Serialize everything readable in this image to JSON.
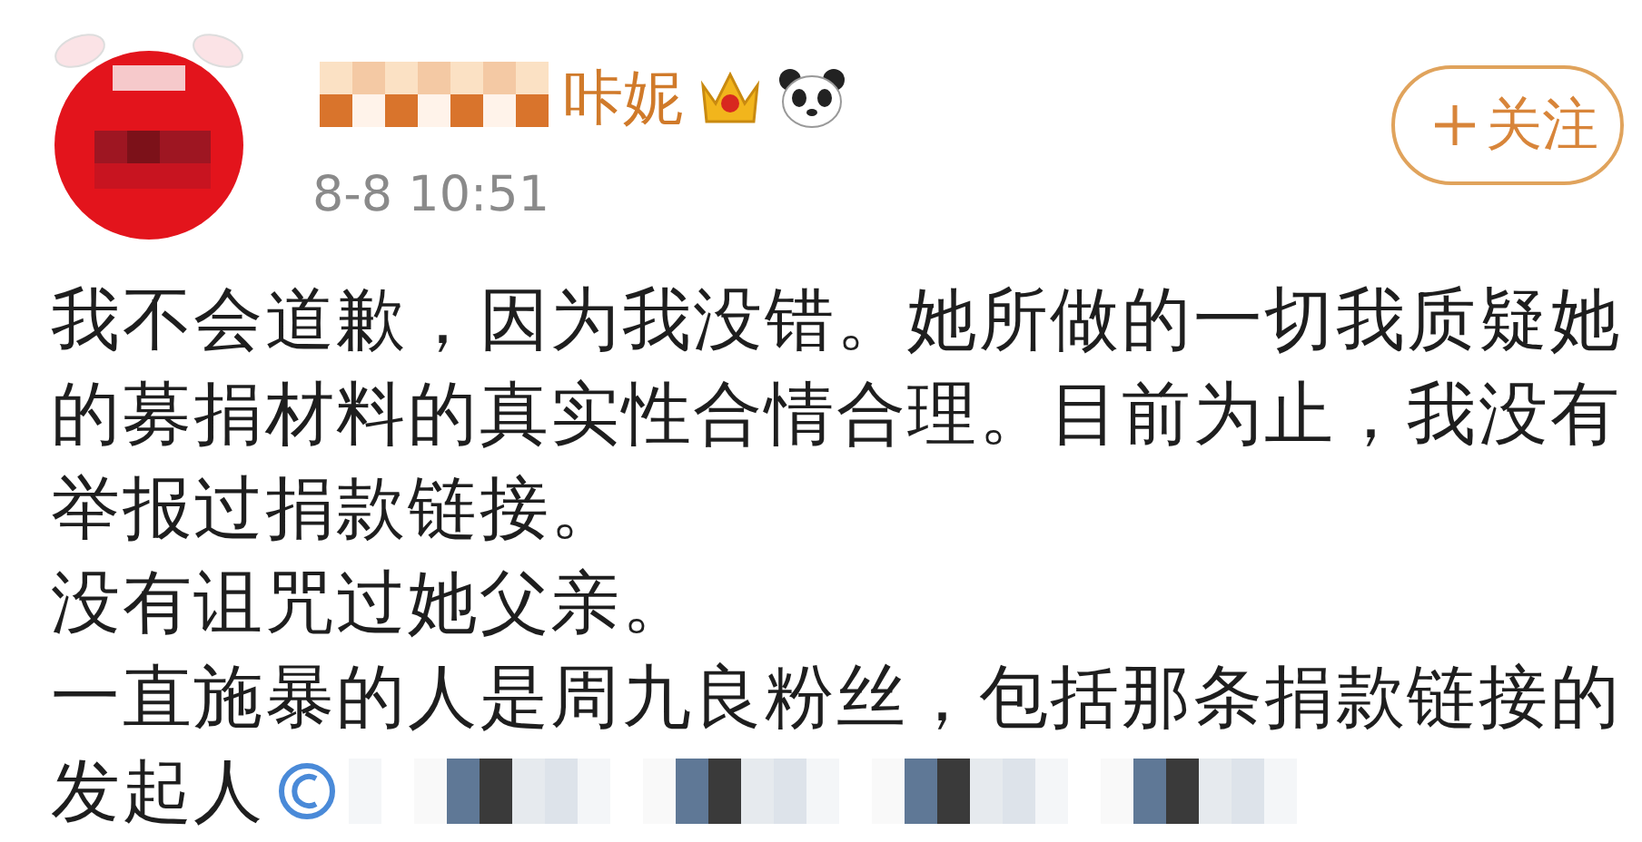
{
  "author": {
    "name": "咔妮",
    "time": "8-8 10:51"
  },
  "follow_button": {
    "label": "关注"
  },
  "paragraphs": [
    "我不会道歉，因为我没错。她所做的一切我质疑她的募捐材料的真实性合情合理。目前为止，我没有举报过捐款链接。",
    "没有诅咒过她父亲。",
    "一直施暴的人是周九良粉丝，包括那条捐款链接的",
    "发起人"
  ]
}
